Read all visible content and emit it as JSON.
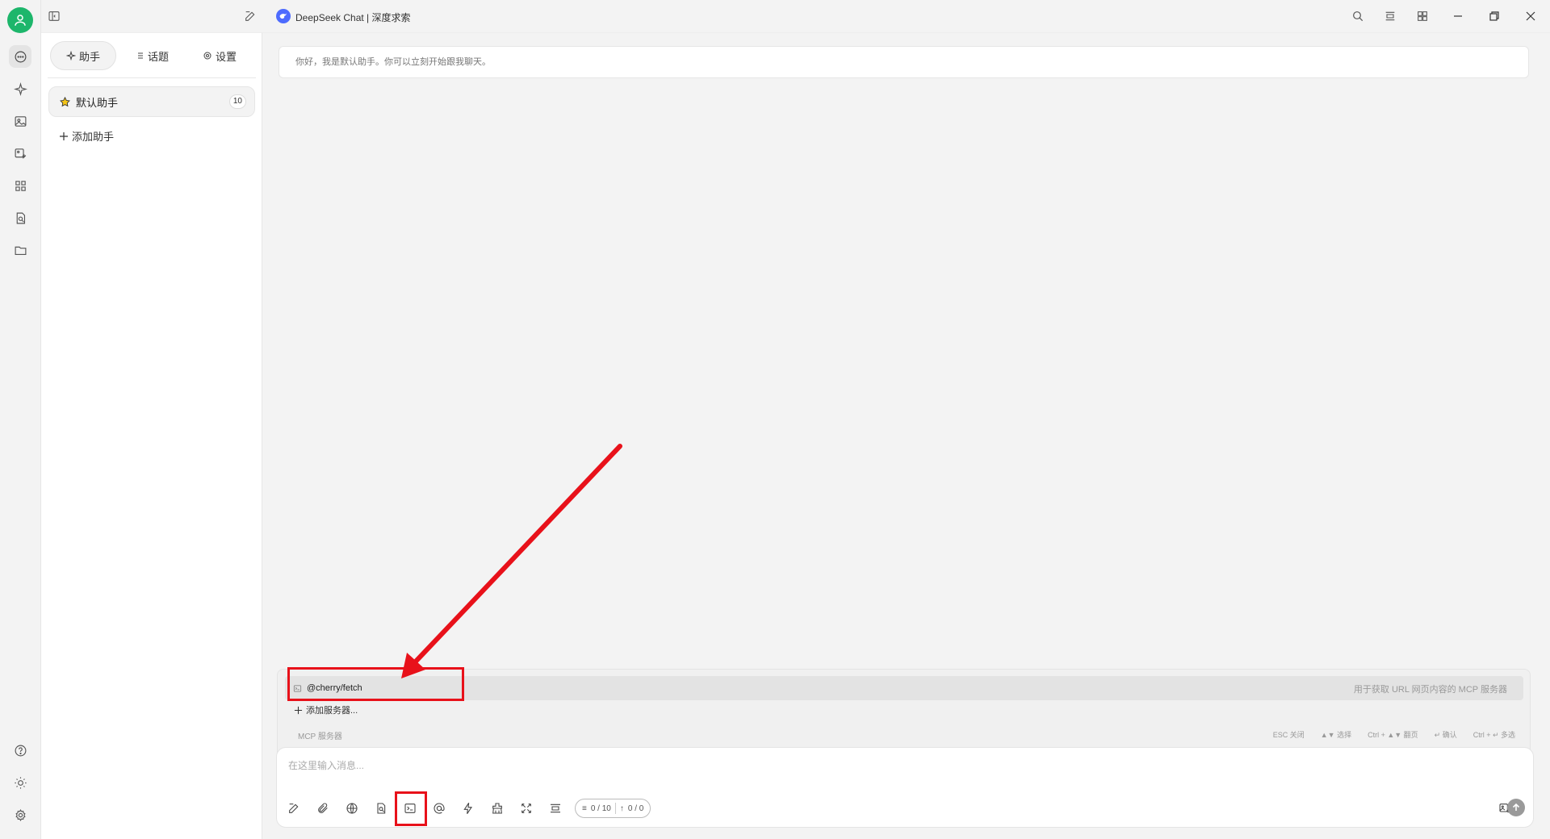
{
  "window": {
    "model_title": "DeepSeek Chat | 深度求索"
  },
  "rail": {
    "items": [
      {
        "icon": "chat-bubble-icon",
        "active": true
      },
      {
        "icon": "sparkle-icon"
      },
      {
        "icon": "image-icon"
      },
      {
        "icon": "image-edit-icon"
      },
      {
        "icon": "apps-grid-icon"
      },
      {
        "icon": "document-search-icon"
      },
      {
        "icon": "folder-icon"
      }
    ],
    "bottom": [
      {
        "icon": "help-icon"
      },
      {
        "icon": "theme-sun-icon"
      },
      {
        "icon": "settings-gear-icon"
      }
    ]
  },
  "panel": {
    "tabs": [
      {
        "label": "助手",
        "icon": "sparkle-icon",
        "active": true
      },
      {
        "label": "话题",
        "icon": "list-icon"
      },
      {
        "label": "设置",
        "icon": "gear-icon"
      }
    ],
    "assistant": {
      "name": "默认助手",
      "count": "10",
      "icon": "star-icon"
    },
    "add_assistant": "添加助手"
  },
  "main": {
    "greeting": "你好，我是默认助手。你可以立刻开始跟我聊天。"
  },
  "mcp_popup": {
    "item_label": "@cherry/fetch",
    "item_desc": "用于获取 URL 网页内容的 MCP 服务器",
    "add_server": "添加服务器...",
    "footer_title": "MCP 服务器",
    "hints": [
      "ESC 关闭",
      "▲▼ 选择",
      "Ctrl + ▲▼ 翻页",
      "↵ 确认",
      "Ctrl + ↵ 多选"
    ]
  },
  "input": {
    "placeholder": "在这里输入消息...",
    "counter_context": "0 / 10",
    "counter_tokens": "0 / 0"
  },
  "colors": {
    "accent_green": "#1db66b",
    "deepseek_blue": "#4d6bfe",
    "annotation_red": "#e8111a"
  }
}
